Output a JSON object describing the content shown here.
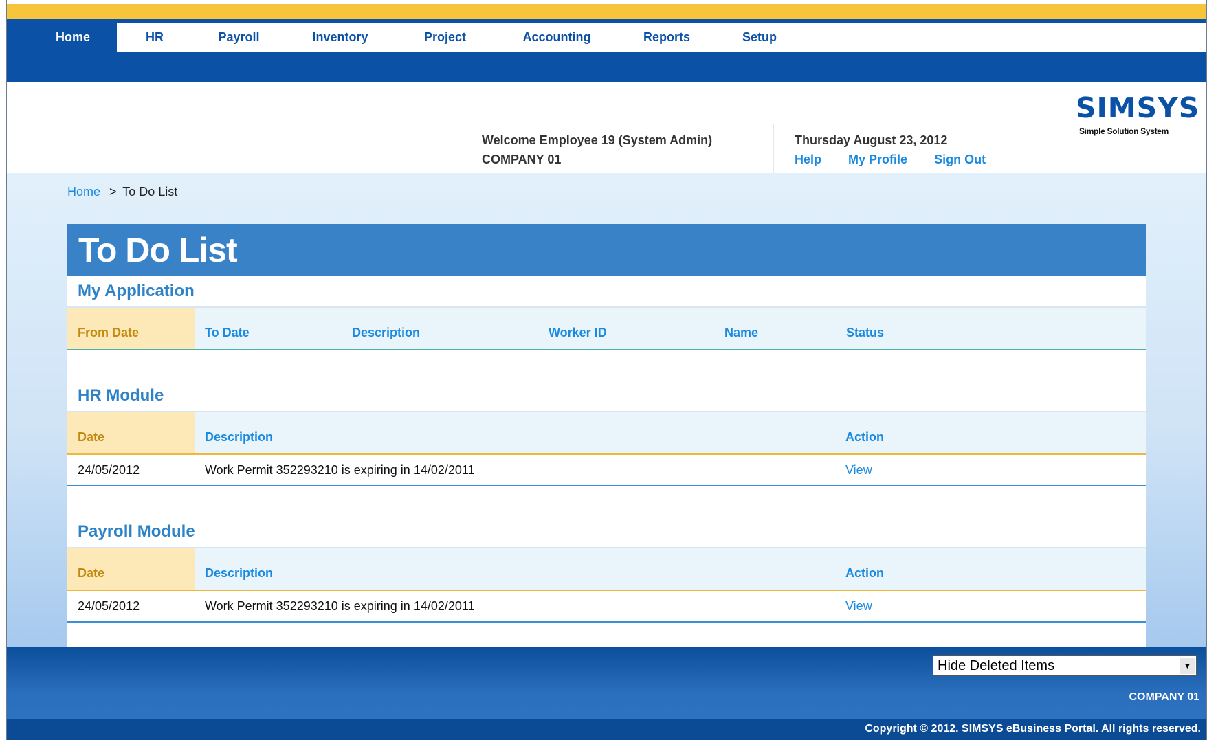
{
  "nav": {
    "items": [
      {
        "label": "Home"
      },
      {
        "label": "HR"
      },
      {
        "label": "Payroll"
      },
      {
        "label": "Inventory"
      },
      {
        "label": "Project"
      },
      {
        "label": "Accounting"
      },
      {
        "label": "Reports"
      },
      {
        "label": "Setup"
      }
    ],
    "active": "Home"
  },
  "header": {
    "welcome": "Welcome Employee 19 (System Admin)",
    "company": "COMPANY 01",
    "date": "Thursday August 23, 2012",
    "links": {
      "help": "Help",
      "profile": "My Profile",
      "signout": "Sign Out"
    },
    "logo": {
      "text": "SIMSYS",
      "tagline": "Simple Solution System"
    }
  },
  "breadcrumb": {
    "home": "Home",
    "separator": ">",
    "current": "To Do List"
  },
  "page": {
    "title": "To Do List"
  },
  "my_application": {
    "title": "My Application",
    "columns": [
      "From Date",
      "To Date",
      "Description",
      "Worker ID",
      "Name",
      "Status"
    ]
  },
  "hr_module": {
    "title": "HR Module",
    "columns": [
      "Date",
      "Description",
      "Action"
    ],
    "rows": [
      {
        "date": "24/05/2012",
        "description": "Work Permit 352293210 is expiring in 14/02/2011",
        "action": "View"
      }
    ]
  },
  "payroll_module": {
    "title": "Payroll Module",
    "columns": [
      "Date",
      "Description",
      "Action"
    ],
    "rows": [
      {
        "date": "24/05/2012",
        "description": "Work Permit 352293210 is expiring in 14/02/2011",
        "action": "View"
      }
    ]
  },
  "footer": {
    "filter_selected": "Hide Deleted Items",
    "company": "COMPANY 01",
    "copyright": "Copyright © 2012. SIMSYS eBusiness Portal. All rights reserved."
  },
  "colors": {
    "primary_blue": "#0b52a7",
    "gold": "#f6c53b",
    "title_blue": "#3a82c8",
    "link_blue": "#1a8ae0"
  }
}
